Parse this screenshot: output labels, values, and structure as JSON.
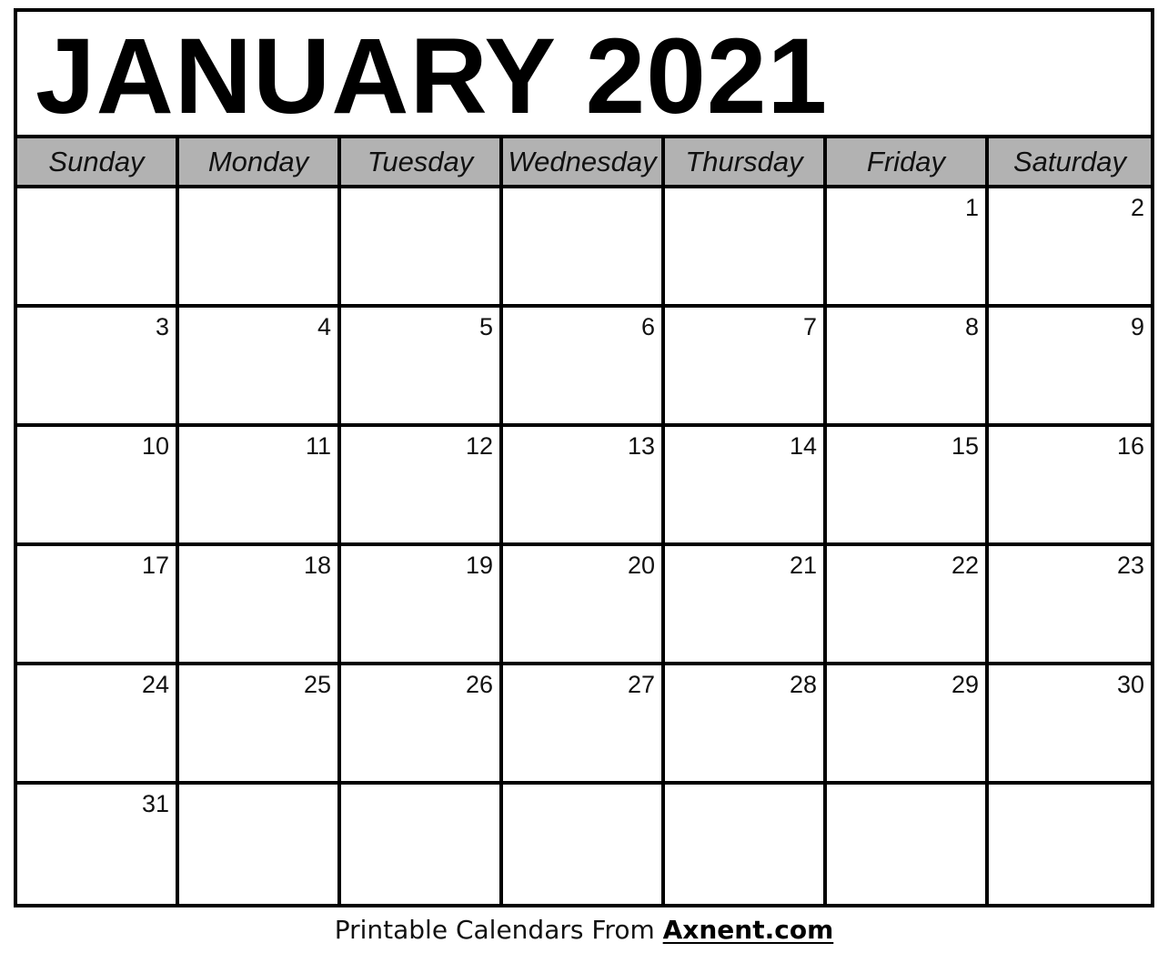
{
  "title": "JANUARY 2021",
  "weekdays": [
    "Sunday",
    "Monday",
    "Tuesday",
    "Wednesday",
    "Thursday",
    "Friday",
    "Saturday"
  ],
  "weeks": [
    [
      "",
      "",
      "",
      "",
      "",
      "1",
      "2"
    ],
    [
      "3",
      "4",
      "5",
      "6",
      "7",
      "8",
      "9"
    ],
    [
      "10",
      "11",
      "12",
      "13",
      "14",
      "15",
      "16"
    ],
    [
      "17",
      "18",
      "19",
      "20",
      "21",
      "22",
      "23"
    ],
    [
      "24",
      "25",
      "26",
      "27",
      "28",
      "29",
      "30"
    ],
    [
      "31",
      "",
      "",
      "",
      "",
      "",
      ""
    ]
  ],
  "colors": {
    "header_bg": "#b2b2b2",
    "border": "#000000",
    "background": "#ffffff"
  },
  "footer": {
    "prefix": "Printable Calendars From ",
    "link": "Axnent.com"
  }
}
